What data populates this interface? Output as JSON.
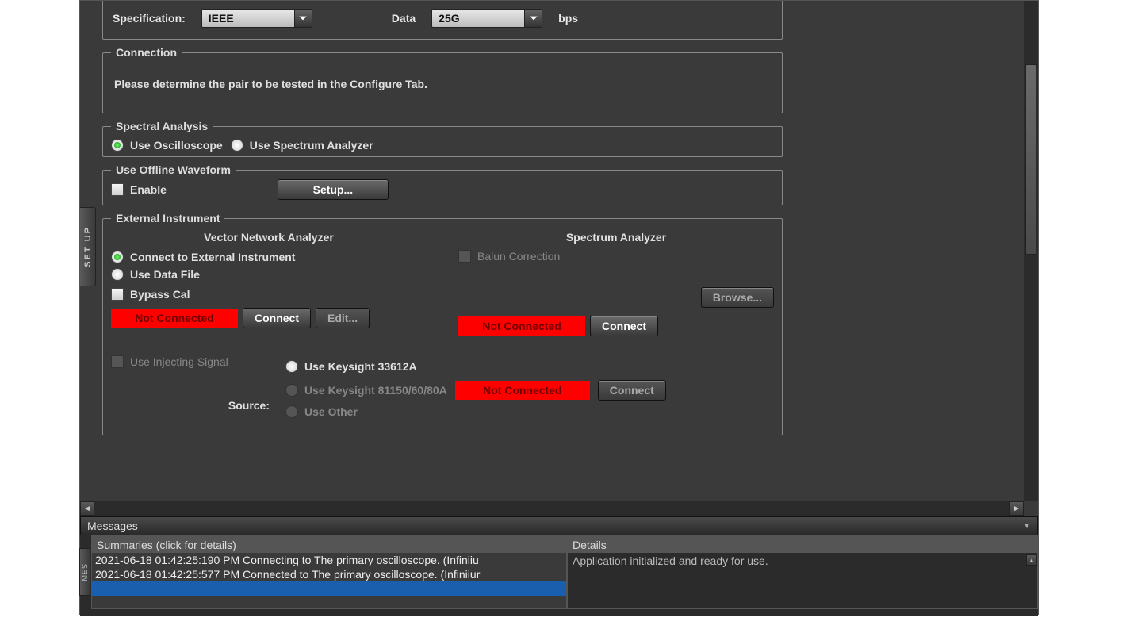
{
  "vtab_label": "SET UP",
  "spec": {
    "specification_label": "Specification:",
    "specification_value": "IEEE",
    "data_label": "Data",
    "data_value": "25G",
    "data_unit": "bps"
  },
  "connection": {
    "legend": "Connection",
    "message": "Please determine the pair to be tested in the Configure Tab."
  },
  "spectral": {
    "legend": "Spectral Analysis",
    "opt_oscope": "Use Oscilloscope",
    "opt_spectrum": "Use Spectrum Analyzer"
  },
  "offline": {
    "legend": "Use Offline Waveform",
    "enable": "Enable",
    "setup_btn": "Setup..."
  },
  "ext": {
    "legend": "External Instrument",
    "vna_header": "Vector Network Analyzer",
    "sa_header": "Spectrum Analyzer",
    "opt_connect_ext": "Connect to External Instrument",
    "opt_datafile": "Use Data File",
    "bypass_cal": "Bypass Cal",
    "balun": "Balun Correction",
    "browse_btn": "Browse...",
    "not_connected": "Not Connected",
    "connect_btn": "Connect",
    "edit_btn": "Edit...",
    "inject": "Use Injecting Signal",
    "src_33612": "Use Keysight 33612A",
    "src_81150": "Use Keysight 81150/60/80A",
    "src_other": "Use Other",
    "source_label": "Source:"
  },
  "messages": {
    "panel_title": "Messages",
    "summaries_header": "Summaries (click for details)",
    "details_header": "Details",
    "vtab": "MES",
    "rows": [
      "2021-06-18 01:42:25:190 PM Connecting to The primary oscilloscope. (Infiniiu",
      "2021-06-18 01:42:25:577 PM Connected to The primary oscilloscope. (Infiniiur"
    ],
    "details_text": "Application initialized and ready for use."
  }
}
